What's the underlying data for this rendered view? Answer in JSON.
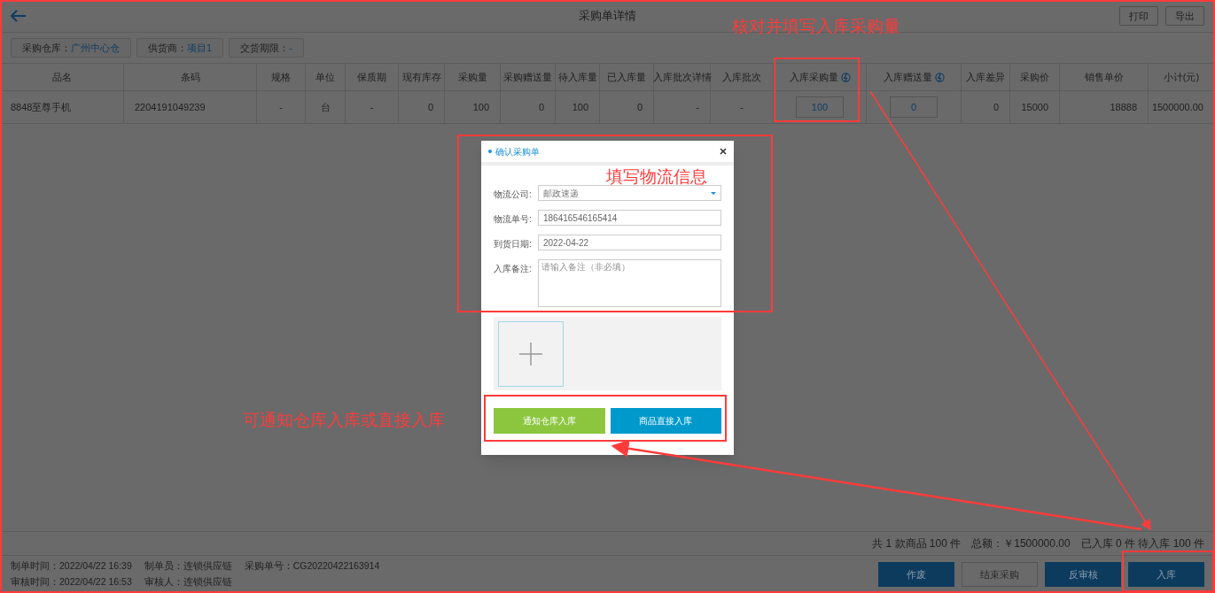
{
  "header": {
    "title": "采购单详情",
    "buttons": [
      "打印",
      "导出"
    ]
  },
  "filters": [
    {
      "label": "采购仓库：",
      "value": "广州中心仓"
    },
    {
      "label": "供货商：",
      "value": "项目1"
    },
    {
      "label": "交货期限：",
      "value": "-"
    }
  ],
  "table": {
    "columns": [
      {
        "label": "品名",
        "kind": "text"
      },
      {
        "label": "条码",
        "kind": "text"
      },
      {
        "label": "规格",
        "kind": "center"
      },
      {
        "label": "单位",
        "kind": "center"
      },
      {
        "label": "保质期",
        "kind": "center"
      },
      {
        "label": "现有库存",
        "kind": "number"
      },
      {
        "label": "采购量",
        "kind": "number"
      },
      {
        "label": "采购赠送量",
        "kind": "number"
      },
      {
        "label": "待入库量",
        "kind": "number"
      },
      {
        "label": "已入库量",
        "kind": "number"
      },
      {
        "label": "入库批次详情",
        "kind": "number"
      },
      {
        "label": "入库批次",
        "kind": "center"
      },
      {
        "label": "入库采购量",
        "kind": "input"
      },
      {
        "label": "入库赠送量",
        "kind": "input"
      },
      {
        "label": "入库差异",
        "kind": "number"
      },
      {
        "label": "采购价",
        "kind": "number"
      },
      {
        "label": "销售单价",
        "kind": "number"
      },
      {
        "label": "小计(元)",
        "kind": "number"
      }
    ],
    "rows": [
      {
        "cells": [
          "8848至尊手机",
          "2204191049239",
          "-",
          "台",
          "-",
          "0",
          "100",
          "0",
          "100",
          "0",
          "-",
          "-",
          "100",
          "0",
          "0",
          "15000",
          "18888",
          "1500000.00"
        ]
      }
    ]
  },
  "summary": [
    "共 1 款商品 100 件",
    "总额：￥1500000.00",
    "已入库 0 件 待入库 100 件"
  ],
  "footer": {
    "info": [
      [
        "制单时间：2022/04/22 16:39",
        "制单员：连锁供应链",
        "采购单号：CG20220422163914"
      ],
      [
        "审核时间：2022/04/22 16:53",
        "审核人：连锁供应链"
      ]
    ],
    "buttons": [
      {
        "label": "作废",
        "kind": "primary"
      },
      {
        "label": "结束采购",
        "kind": "outline"
      },
      {
        "label": "反审核",
        "kind": "primary"
      },
      {
        "label": "入库",
        "kind": "primary"
      }
    ]
  },
  "dialog": {
    "title": "确认采购单",
    "fields": [
      {
        "label": "物流公司:",
        "kind": "select",
        "value": "邮政速递"
      },
      {
        "label": "物流单号:",
        "kind": "input",
        "value": "186416546165414"
      },
      {
        "label": "到货日期:",
        "kind": "input",
        "value": "2022-04-22"
      },
      {
        "label": "入库备注:",
        "kind": "textarea",
        "placeholder": "请输入备注（非必填）"
      }
    ],
    "buttons": [
      {
        "label": "通知仓库入库",
        "color": "#8cc63f"
      },
      {
        "label": "商品直接入库",
        "color": "#0099cc"
      }
    ]
  },
  "annotations": [
    "核对并填写入库采购量",
    "填写物流信息",
    "可通知仓库入库或直接入库"
  ]
}
